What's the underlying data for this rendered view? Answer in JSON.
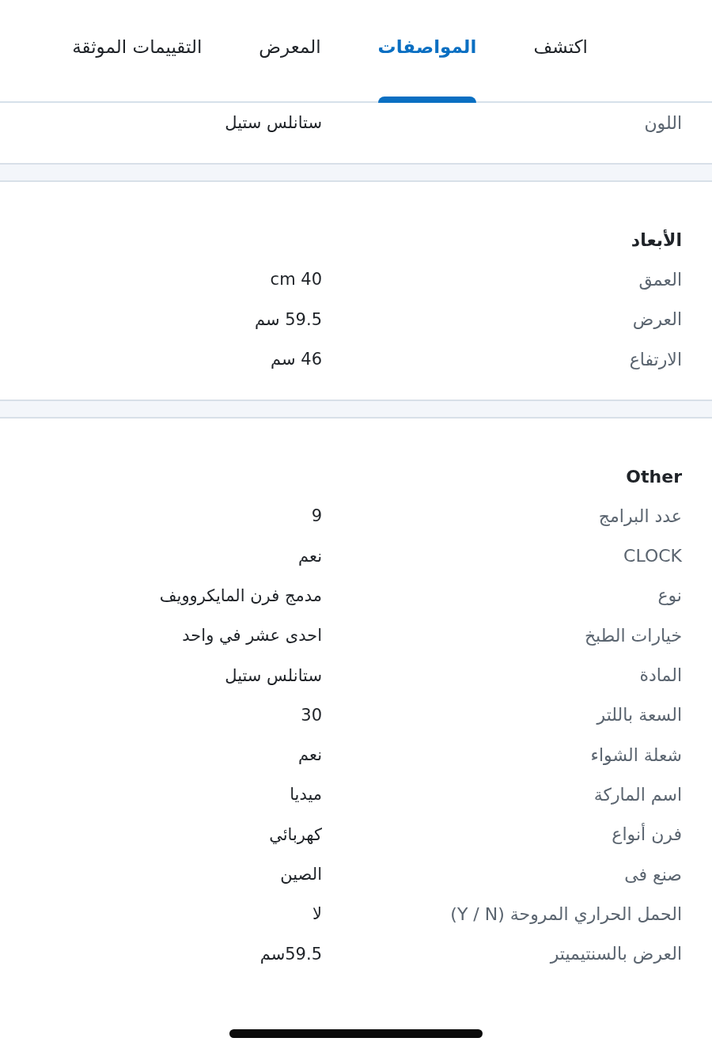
{
  "tabs": [
    {
      "label": "اكتشف",
      "selected": false
    },
    {
      "label": "المواصفات",
      "selected": true
    },
    {
      "label": "المعرض",
      "selected": false
    },
    {
      "label": "التقييمات الموثقة",
      "selected": false
    }
  ],
  "sections": [
    {
      "rows": [
        {
          "label": "اللون",
          "value": "ستانلس ستيل"
        }
      ]
    },
    {
      "title": "الأبعاد",
      "rows": [
        {
          "label": "العمق",
          "value": "cm 40"
        },
        {
          "label": "العرض",
          "value": "59.5 سم"
        },
        {
          "label": "الارتفاع",
          "value": "46 سم"
        }
      ]
    },
    {
      "title": "Other",
      "rows": [
        {
          "label": "عدد البرامج",
          "value": "9"
        },
        {
          "label": "CLOCK",
          "value": "نعم"
        },
        {
          "label": "نوع",
          "value": "مدمج فرن المايكروويف"
        },
        {
          "label": "خيارات الطبخ",
          "value": "احدى عشر في واحد"
        },
        {
          "label": "المادة",
          "value": "ستانلس ستيل"
        },
        {
          "label": "السعة باللتر",
          "value": "30"
        },
        {
          "label": "شعلة الشواء",
          "value": "نعم"
        },
        {
          "label": "اسم الماركة",
          "value": "ميديا"
        },
        {
          "label": "فرن أنواع",
          "value": "كهربائي"
        },
        {
          "label": "صنع فى",
          "value": "الصين"
        },
        {
          "label": "الحمل الحراري المروحة (Y / N)",
          "value": "لا"
        },
        {
          "label": "العرض بالسنتيميتر",
          "value": "59.5سم"
        }
      ]
    }
  ]
}
